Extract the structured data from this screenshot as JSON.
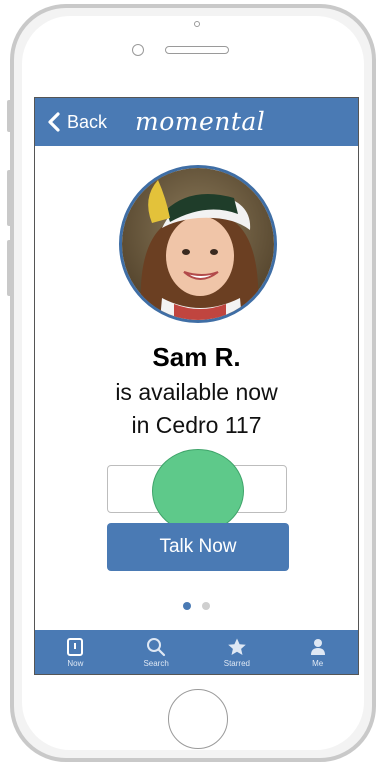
{
  "header": {
    "back_label": "Back",
    "brand": "momental"
  },
  "profile": {
    "name": "Sam R.",
    "status": "is available now",
    "location": "in Cedro 117"
  },
  "action": {
    "talk_label": "Talk Now"
  },
  "pager": {
    "count": 2,
    "active": 0
  },
  "tabs": [
    {
      "label": "Now",
      "icon": "now-icon"
    },
    {
      "label": "Search",
      "icon": "search-icon"
    },
    {
      "label": "Starred",
      "icon": "star-icon"
    },
    {
      "label": "Me",
      "icon": "person-icon"
    }
  ],
  "colors": {
    "accent": "#4a7ab4",
    "touch_indicator": "#5ec98a"
  }
}
